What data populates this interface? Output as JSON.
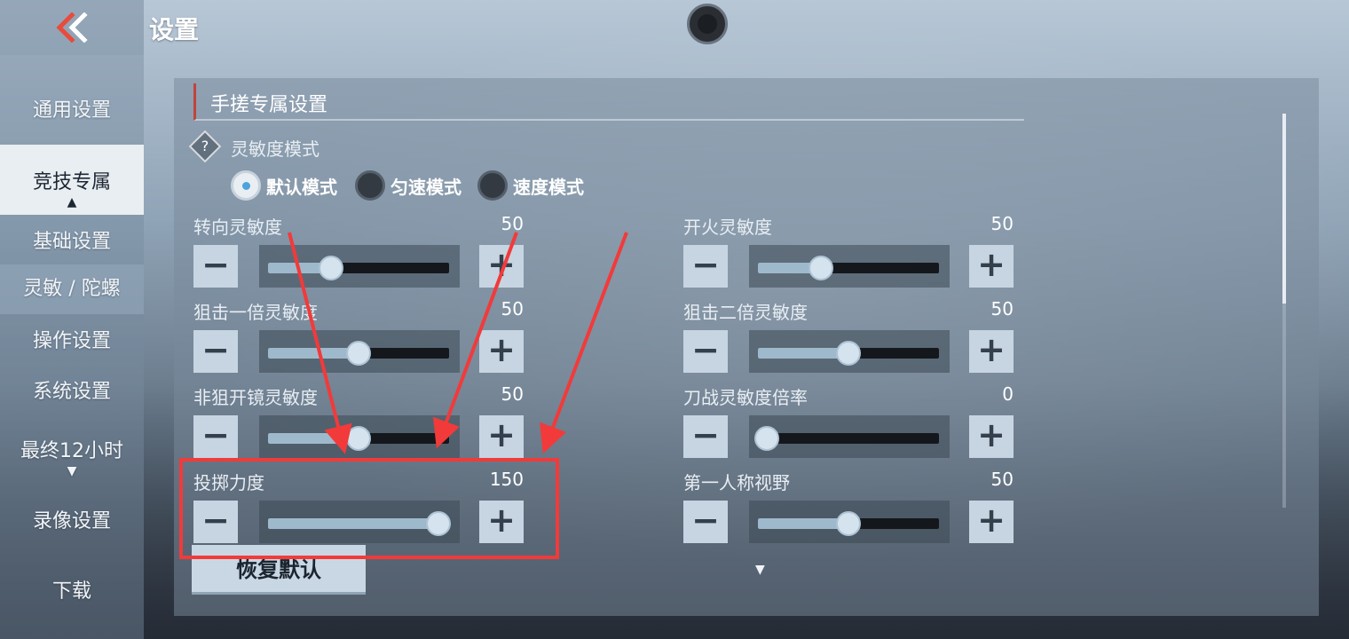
{
  "header": {
    "title": "设置"
  },
  "sidebar": {
    "items": [
      {
        "label": "通用设置"
      },
      {
        "label": "竞技专属"
      },
      {
        "label": "基础设置"
      },
      {
        "label": "灵敏 / 陀螺"
      },
      {
        "label": "操作设置"
      },
      {
        "label": "系统设置"
      },
      {
        "label": "最终12小时"
      },
      {
        "label": "录像设置"
      },
      {
        "label": "下载"
      }
    ]
  },
  "section": {
    "title": "手搓专属设置",
    "mode_label": "灵敏度模式",
    "help_glyph": "?",
    "modes": [
      {
        "label": "默认模式",
        "selected": true
      },
      {
        "label": "匀速模式",
        "selected": false
      },
      {
        "label": "速度模式",
        "selected": false
      }
    ]
  },
  "sliders": {
    "left": [
      {
        "label": "转向灵敏度",
        "value": "50",
        "fill": 0.35
      },
      {
        "label": "狙击一倍灵敏度",
        "value": "50",
        "fill": 0.5
      },
      {
        "label": "非狙开镜灵敏度",
        "value": "50",
        "fill": 0.5
      },
      {
        "label": "投掷力度",
        "value": "150",
        "fill": 0.94
      }
    ],
    "right": [
      {
        "label": "开火灵敏度",
        "value": "50",
        "fill": 0.35
      },
      {
        "label": "狙击二倍灵敏度",
        "value": "50",
        "fill": 0.5
      },
      {
        "label": "刀战灵敏度倍率",
        "value": "0",
        "fill": 0.05
      },
      {
        "label": "第一人称视野",
        "value": "50",
        "fill": 0.5
      }
    ],
    "minus_glyph": "−",
    "plus_glyph": "+"
  },
  "reset_button": {
    "label": "恢复默认"
  },
  "icons": {
    "back": "double-chevron-left-icon",
    "camera": "front-camera-icon",
    "sidebar_expand_up": "triangle-up-icon",
    "sidebar_expand_down": "triangle-down-icon",
    "more": "triangle-down-icon"
  },
  "colors": {
    "annotation_red": "#f23a3a",
    "selected_radio_dot": "#4aa3dd",
    "accent_bar": "#c0443c"
  }
}
